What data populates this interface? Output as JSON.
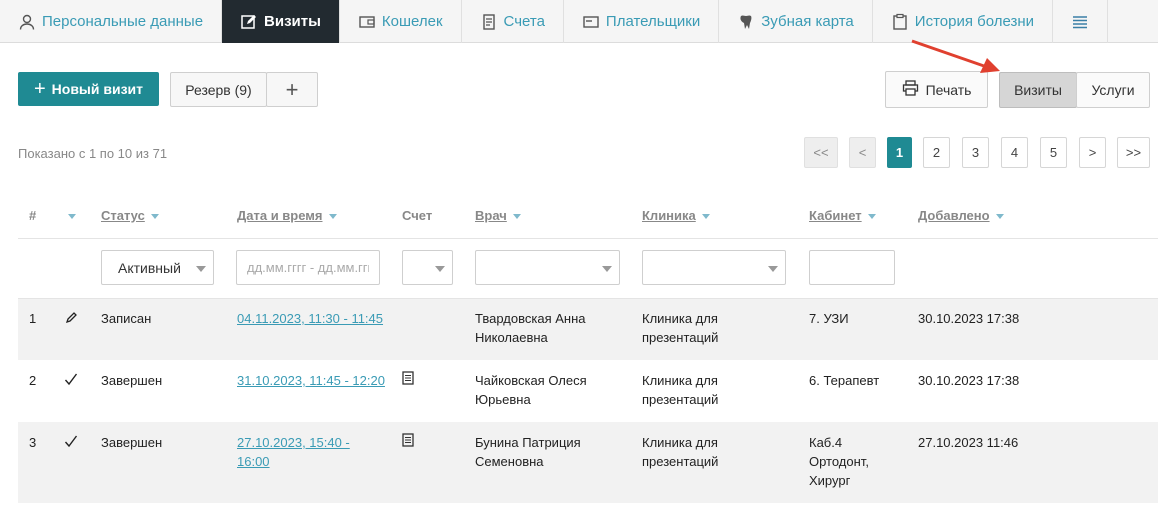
{
  "tabs": [
    {
      "label": "Персональные данные",
      "icon": "person-icon"
    },
    {
      "label": "Визиты",
      "icon": "edit-icon"
    },
    {
      "label": "Кошелек",
      "icon": "wallet-icon"
    },
    {
      "label": "Счета",
      "icon": "invoice-icon"
    },
    {
      "label": "Плательщики",
      "icon": "card-icon"
    },
    {
      "label": "Зубная карта",
      "icon": "tooth-icon"
    },
    {
      "label": "История болезни",
      "icon": "clipboard-icon"
    }
  ],
  "toolbar": {
    "new_visit": "Новый визит",
    "reserve": "Резерв (9)",
    "print": "Печать",
    "visits": "Визиты",
    "services": "Услуги"
  },
  "pagination": {
    "shown": "Показано с 1 по 10 из 71",
    "first": "<<",
    "prev": "<",
    "pages": [
      "1",
      "2",
      "3",
      "4",
      "5"
    ],
    "next": ">",
    "last": ">>"
  },
  "table": {
    "headers": {
      "num": "#",
      "status": "Статус",
      "datetime": "Дата и время",
      "invoice": "Счет",
      "doctor": "Врач",
      "clinic": "Клиника",
      "room": "Кабинет",
      "added": "Добавлено"
    },
    "filters": {
      "status_value": "Активный",
      "date_placeholder": "дд.мм.гггг - дд.мм.гггг"
    },
    "rows": [
      {
        "num": "1",
        "status": "Записан",
        "datetime": "04.11.2023, 11:30 - 11:45",
        "doctor": [
          "Твардовская Анна",
          "Николаевна"
        ],
        "clinic": [
          "Клиника для",
          "презентаций"
        ],
        "room": [
          "7. УЗИ"
        ],
        "added": "30.10.2023 17:38",
        "icon": "pencil-icon",
        "has_invoice": false
      },
      {
        "num": "2",
        "status": "Завершен",
        "datetime": "31.10.2023, 11:45 - 12:20",
        "doctor": [
          "Чайковская Олеся",
          "Юрьевна"
        ],
        "clinic": [
          "Клиника для",
          "презентаций"
        ],
        "room": [
          "6. Терапевт"
        ],
        "added": "30.10.2023 17:38",
        "icon": "check-icon",
        "has_invoice": true
      },
      {
        "num": "3",
        "status": "Завершен",
        "datetime": [
          "27.10.2023, 15:40 -",
          "16:00"
        ],
        "doctor": [
          "Бунина Патриция",
          "Семеновна"
        ],
        "clinic": [
          "Клиника для",
          "презентаций"
        ],
        "room": [
          "Каб.4",
          "Ортодонт,",
          "Хирург"
        ],
        "added": "27.10.2023 11:46",
        "icon": "check-icon",
        "has_invoice": true
      }
    ]
  },
  "colors": {
    "accent": "#1f8a93",
    "link": "#3a9bb5",
    "active_tab": "#222a30",
    "arrow": "#e0402f"
  }
}
